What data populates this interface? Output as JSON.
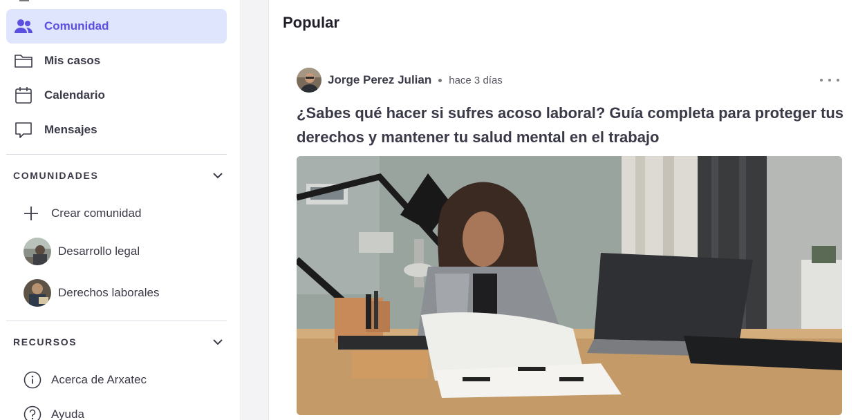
{
  "sidebar": {
    "nav": [
      {
        "label": "Comunidad",
        "icon": "users-icon",
        "active": true
      },
      {
        "label": "Mis casos",
        "icon": "folder-icon",
        "active": false
      },
      {
        "label": "Calendario",
        "icon": "calendar-icon",
        "active": false
      },
      {
        "label": "Mensajes",
        "icon": "chat-bubble-icon",
        "active": false
      }
    ],
    "comunidades": {
      "title": "COMUNIDADES",
      "create_label": "Crear comunidad",
      "items": [
        {
          "label": "Desarrollo legal",
          "icon": "community-avatar"
        },
        {
          "label": "Derechos laborales",
          "icon": "community-avatar"
        }
      ]
    },
    "recursos": {
      "title": "RECURSOS",
      "items": [
        {
          "label": "Acerca de Arxatec",
          "icon": "info-icon"
        },
        {
          "label": "Ayuda",
          "icon": "help-icon"
        }
      ]
    }
  },
  "main": {
    "section_title": "Popular",
    "post": {
      "author": "Jorge Perez Julian",
      "time": "hace 3 días",
      "title": "¿Sabes qué hacer si sufres acoso laboral? Guía completa para proteger tus derechos y mantener tu salud mental en el trabajo"
    }
  },
  "colors": {
    "accent": "#5b4fe0",
    "active_bg": "#dfe5fd",
    "text": "#3a3a48"
  }
}
